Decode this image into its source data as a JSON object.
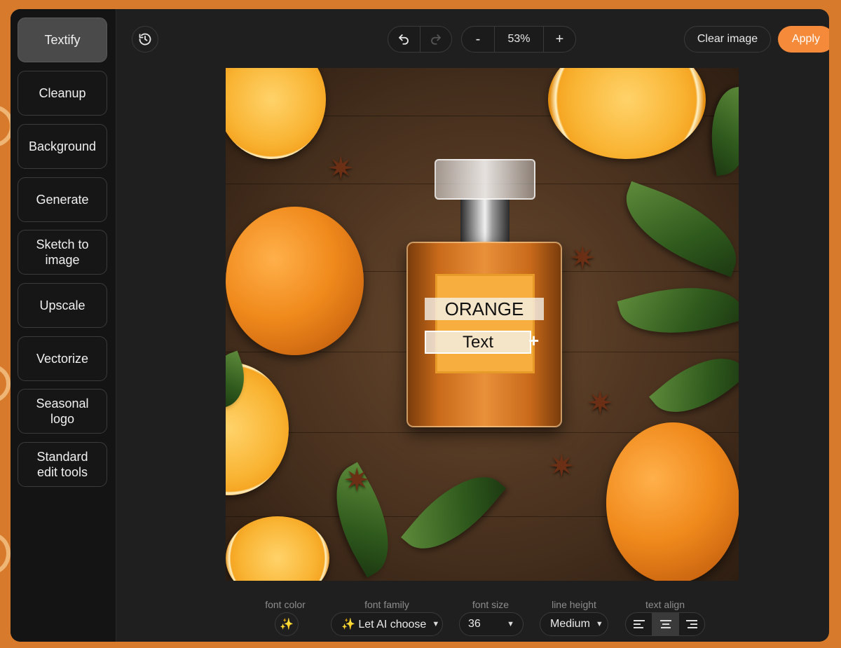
{
  "sidebar": {
    "items": [
      {
        "label": "Textify",
        "active": true
      },
      {
        "label": "Cleanup"
      },
      {
        "label": "Background"
      },
      {
        "label": "Generate"
      },
      {
        "label": "Sketch to image"
      },
      {
        "label": "Upscale"
      },
      {
        "label": "Vectorize"
      },
      {
        "label": "Seasonal logo"
      },
      {
        "label": "Standard edit tools"
      }
    ]
  },
  "toolbar": {
    "history_icon": "history-icon",
    "undo_icon": "undo-icon",
    "redo_icon": "redo-icon",
    "zoom_out": "-",
    "zoom_level": "53%",
    "zoom_in": "+",
    "clear_label": "Clear image",
    "apply_label": "Apply"
  },
  "canvas": {
    "text_boxes": [
      {
        "text": "ORANGE"
      },
      {
        "text": "Text",
        "selected": true
      }
    ]
  },
  "options": {
    "font_color": {
      "label": "font color",
      "value": "✨"
    },
    "font_family": {
      "label": "font family",
      "value": "✨ Let AI choose"
    },
    "font_size": {
      "label": "font size",
      "value": "36"
    },
    "line_height": {
      "label": "line height",
      "value": "Medium"
    },
    "text_align": {
      "label": "text align",
      "selected": "center"
    }
  },
  "colors": {
    "accent": "#f58a3b",
    "frame": "#d77a2b"
  }
}
